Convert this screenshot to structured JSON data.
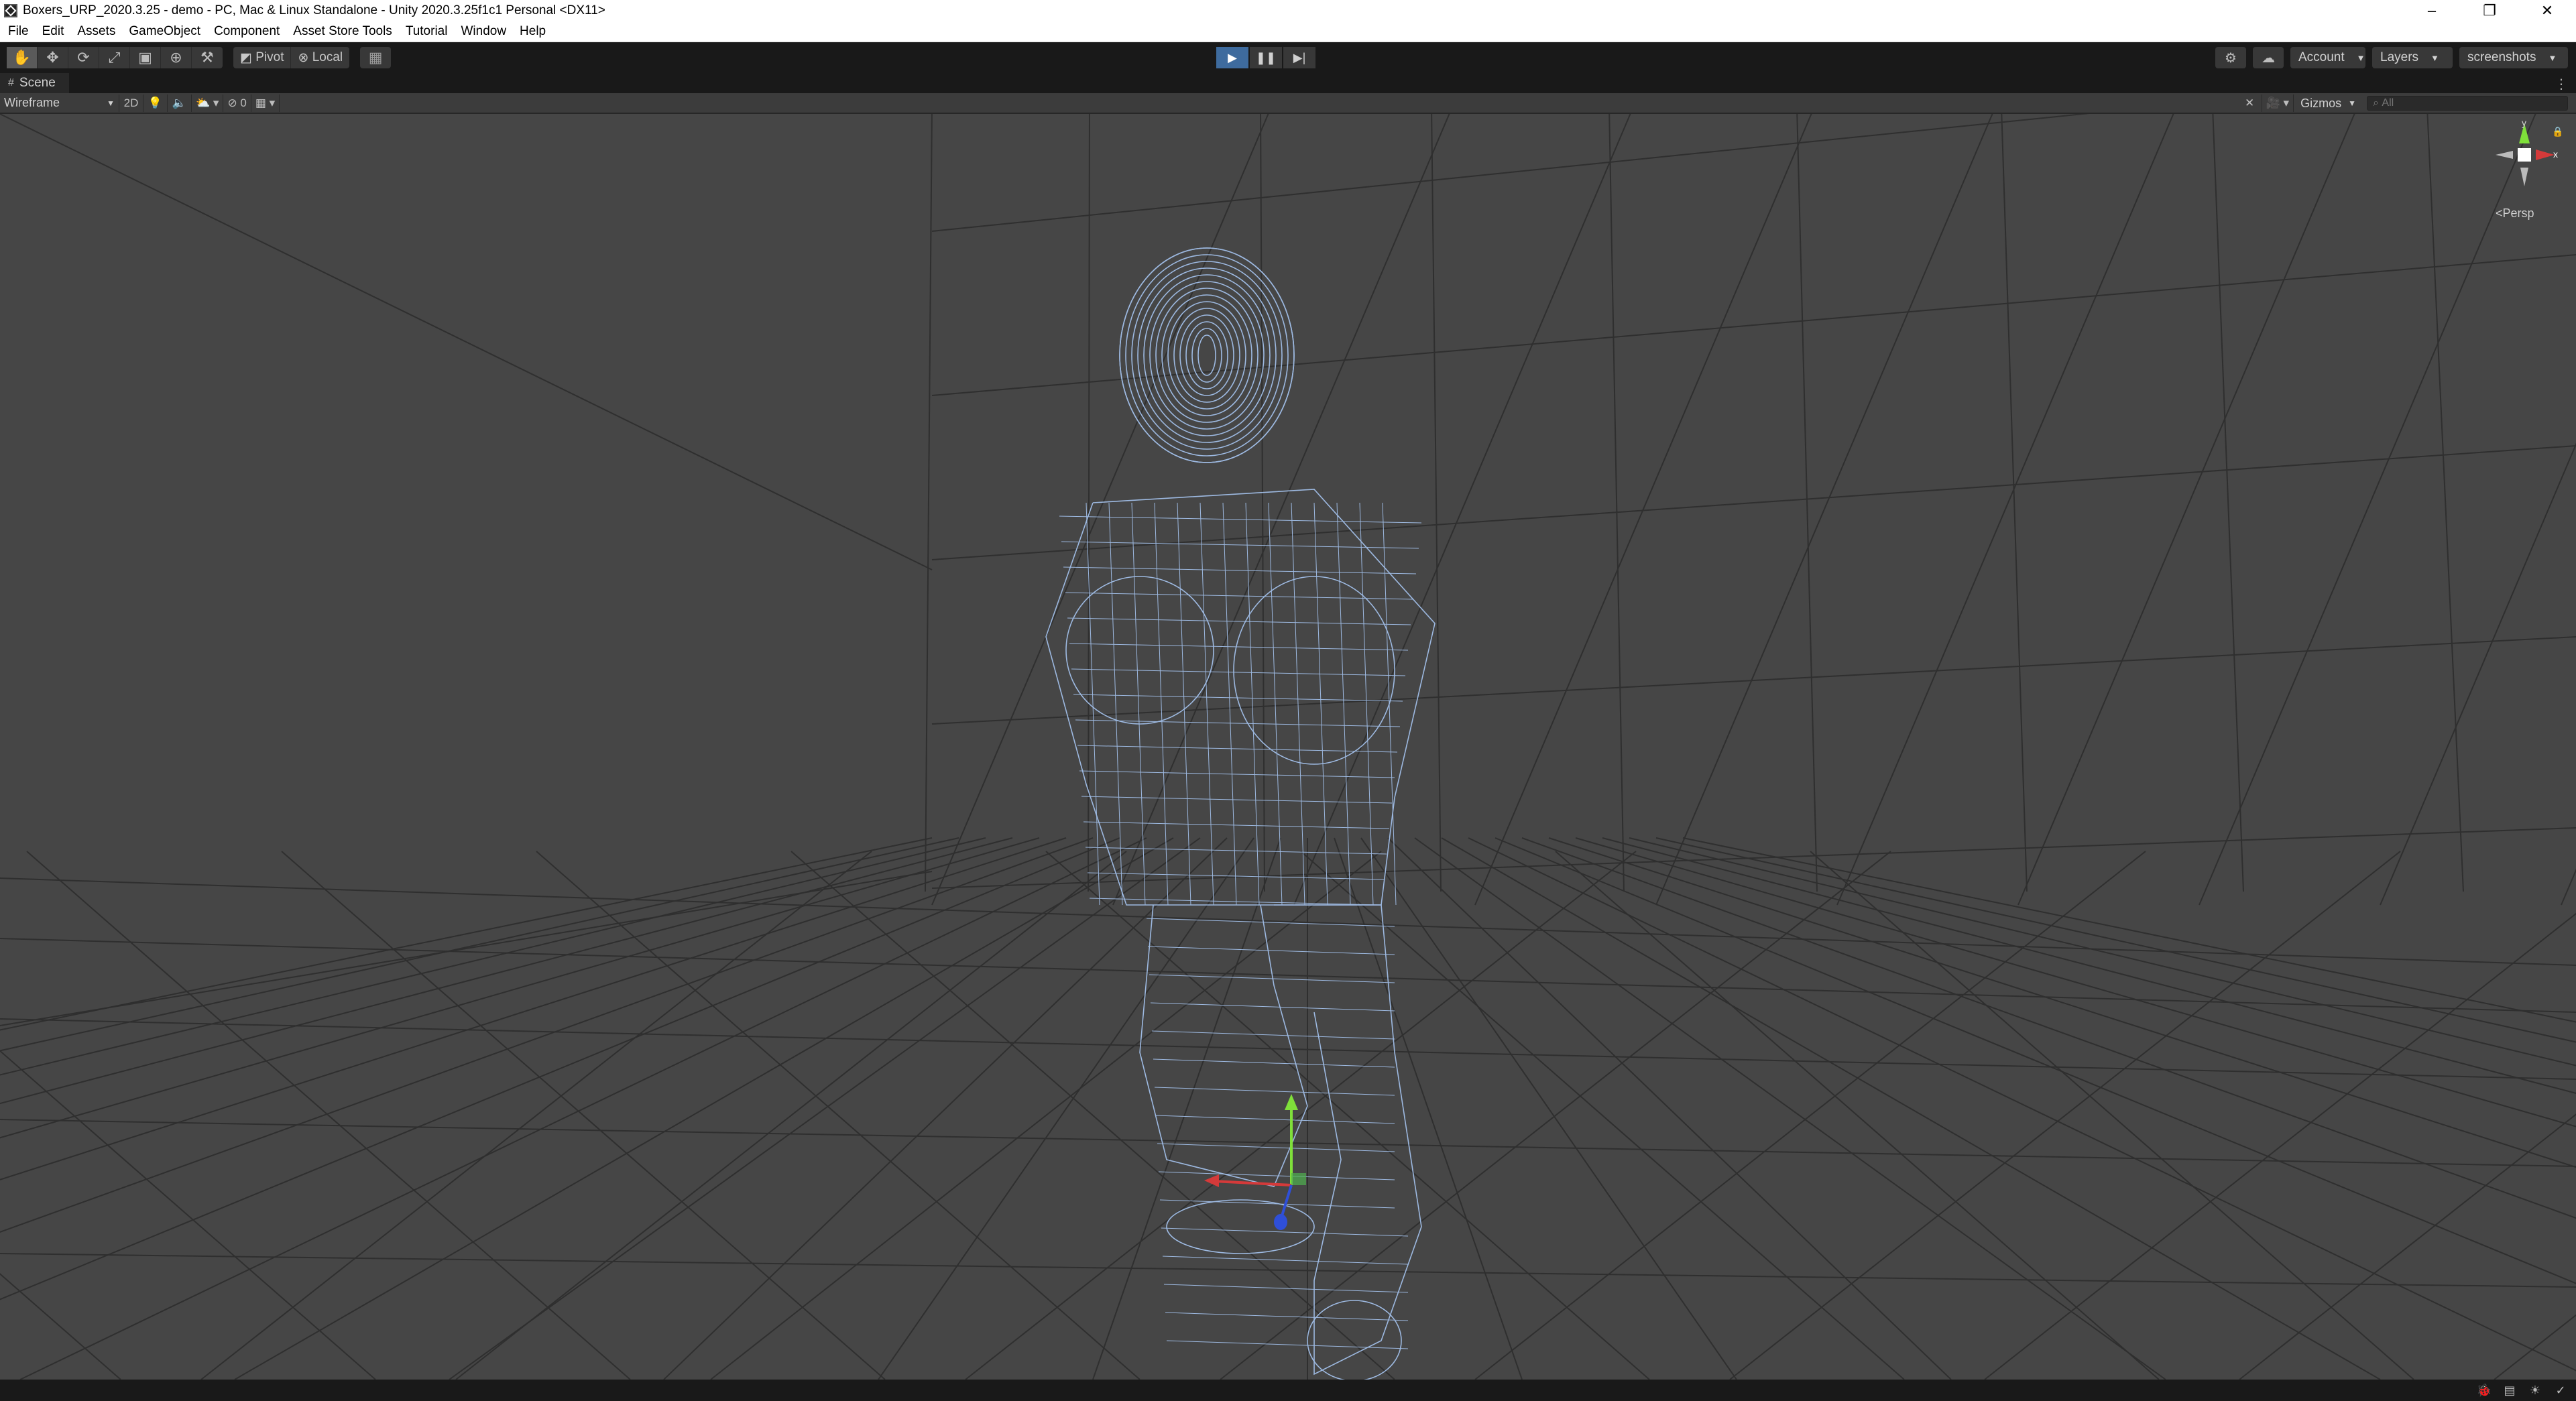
{
  "window": {
    "title": "Boxers_URP_2020.3.25 - demo - PC, Mac & Linux Standalone - Unity 2020.3.25f1c1 Personal <DX11>",
    "controls": {
      "minimize": "–",
      "maximize": "❐",
      "close": "✕"
    }
  },
  "menubar": {
    "items": [
      "File",
      "Edit",
      "Assets",
      "GameObject",
      "Component",
      "Asset Store Tools",
      "Tutorial",
      "Window",
      "Help"
    ]
  },
  "toolbar": {
    "pivot_label": "Pivot",
    "local_label": "Local",
    "account_label": "Account",
    "layers_label": "Layers",
    "layout_label": "screenshots"
  },
  "scene": {
    "tab_label": "Scene",
    "draw_mode": "Wireframe",
    "twod_label": "2D",
    "hidden_count": "0",
    "gizmos_label": "Gizmos",
    "search_placeholder": "All",
    "projection_label": "Persp",
    "axis_labels": {
      "y": "y",
      "x": "x"
    }
  },
  "colors": {
    "viewport_bg": "#464646",
    "grid_line": "#2f2f2f",
    "wireframe": "#a7c6f2",
    "play_accent": "#3e6b9e",
    "axis_x": "#d43a3a",
    "axis_y": "#7fe03a",
    "axis_z": "#2f4fd8"
  },
  "icons": {
    "tools": [
      "hand-tool-icon",
      "move-tool-icon",
      "rotate-tool-icon",
      "scale-tool-icon",
      "rect-tool-icon",
      "transform-tool-icon",
      "custom-tool-icon"
    ],
    "playback": [
      "play-icon",
      "pause-icon",
      "step-icon"
    ],
    "status": [
      "bug-icon",
      "console-icon",
      "lighting-icon",
      "check-icon"
    ]
  }
}
